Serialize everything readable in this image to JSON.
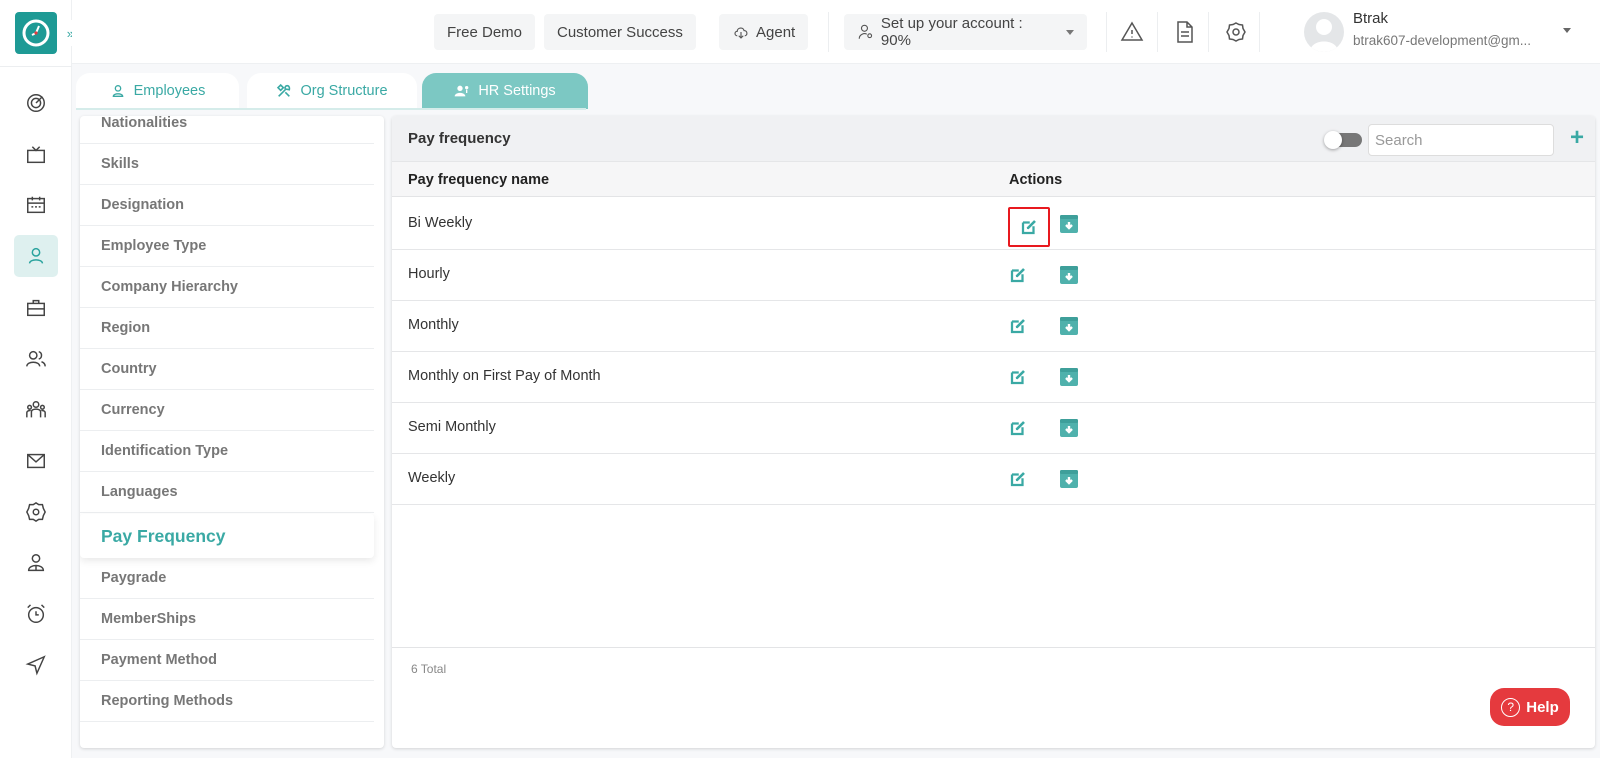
{
  "app": {
    "expand_label": "»»",
    "brand_color": "#1e9a95",
    "accent_color": "#3aa9a4",
    "danger_color": "#e53a3e"
  },
  "header": {
    "free_demo": "Free Demo",
    "customer_success": "Customer Success",
    "agent": "Agent",
    "setup_account": "Set up your account : 90%",
    "user_name": "Btrak",
    "user_email": "btrak607-development@gm..."
  },
  "rail": {
    "items": [
      {
        "icon": "dashboard-icon"
      },
      {
        "icon": "tv-icon"
      },
      {
        "icon": "calendar-icon"
      },
      {
        "icon": "user-icon",
        "active": true
      },
      {
        "icon": "briefcase-icon"
      },
      {
        "icon": "users-icon"
      },
      {
        "icon": "team-icon"
      },
      {
        "icon": "mail-icon"
      },
      {
        "icon": "settings-icon"
      },
      {
        "icon": "profile-icon"
      },
      {
        "icon": "alarm-icon"
      },
      {
        "icon": "send-icon"
      }
    ]
  },
  "tabs": [
    {
      "label": "Employees"
    },
    {
      "label": "Org Structure"
    },
    {
      "label": "HR Settings",
      "active": true
    }
  ],
  "settings_menu": {
    "items": [
      "Nationalities",
      "Skills",
      "Designation",
      "Employee Type",
      "Company Hierarchy",
      "Region",
      "Country",
      "Currency",
      "Identification Type",
      "Languages",
      "Pay Frequency",
      "Paygrade",
      "MemberShips",
      "Payment Method",
      "Reporting Methods"
    ],
    "active": "Pay Frequency"
  },
  "panel": {
    "title": "Pay frequency",
    "search_placeholder": "Search",
    "add_label": "+",
    "columns": {
      "name": "Pay frequency name",
      "actions": "Actions"
    },
    "rows": [
      {
        "name": "Bi Weekly"
      },
      {
        "name": "Hourly"
      },
      {
        "name": "Monthly"
      },
      {
        "name": "Monthly on First Pay of Month"
      },
      {
        "name": "Semi Monthly"
      },
      {
        "name": "Weekly"
      }
    ],
    "total": "6 Total"
  },
  "help": {
    "label": "Help",
    "icon_glyph": "?"
  }
}
